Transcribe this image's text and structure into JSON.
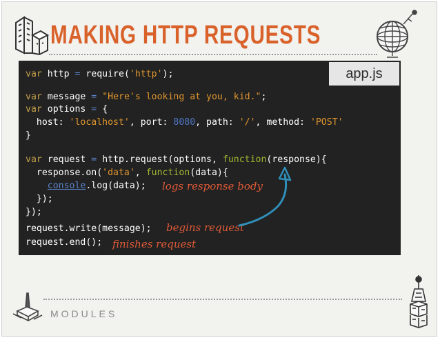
{
  "slide": {
    "title": "MAKING HTTP REQUESTS",
    "footer": "MODULES",
    "file_label": "app.js"
  },
  "code": {
    "line1": {
      "kw": "var",
      "a": " http ",
      "eq": "=",
      "b": " require(",
      "s": "'http'",
      "c": ");"
    },
    "line2": {
      "kw": "var",
      "a": " message ",
      "eq": "=",
      "b": " ",
      "s": "\"Here's looking at you, kid.\"",
      "c": ";"
    },
    "line3": {
      "kw": "var",
      "a": " options ",
      "eq": "=",
      "b": " {"
    },
    "line4": {
      "a": "  host: ",
      "s1": "'localhost'",
      "b": ", port: ",
      "n": "8080",
      "c": ", path: ",
      "s2": "'/'",
      "d": ", method: ",
      "s3": "'POST'"
    },
    "line5": "}",
    "line6": {
      "kw": "var",
      "a": " request ",
      "eq": "=",
      "b": " http.request(options, ",
      "fn": "function",
      "c": "(response){"
    },
    "line7": {
      "a": "  response.on(",
      "s": "'data'",
      "b": ", ",
      "fn": "function",
      "c": "(data){"
    },
    "line8": {
      "a": "    ",
      "cons": "console",
      "b": ".log(data);"
    },
    "line9": "  });",
    "line10": "});",
    "line11": "request.write(message);",
    "line12": "request.end();"
  },
  "annotations": {
    "logs": "logs response body",
    "begins": "begins request",
    "finishes": "finishes request"
  },
  "icons": [
    "building-icon",
    "globe-icon",
    "monument-icon",
    "radio-tower-icon"
  ]
}
